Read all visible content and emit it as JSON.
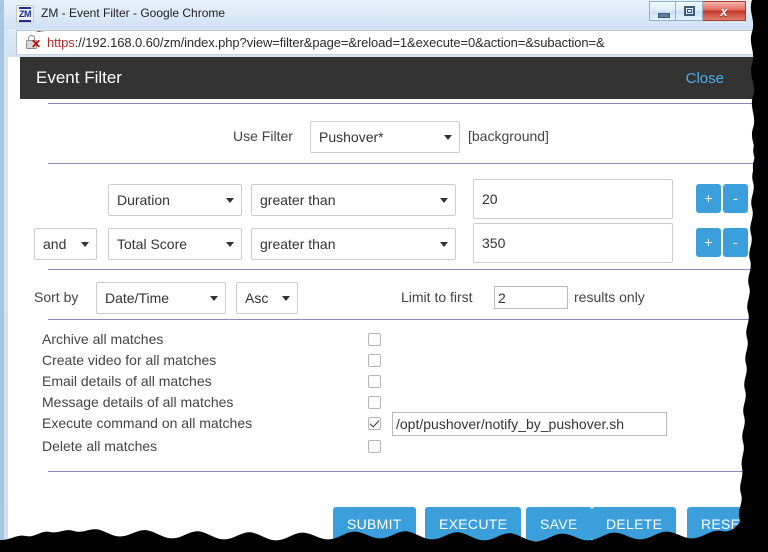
{
  "window": {
    "title": "ZM - Event Filter - Google Chrome",
    "favicon": "zm-favicon",
    "minimize_label": "Minimize",
    "maximize_label": "Maximize",
    "close_label": "x"
  },
  "omnibox": {
    "icon": "broken-https-lock-icon",
    "scheme": "https",
    "rest": "://192.168.0.60/zm/index.php?view=filter&page=&reload=1&execute=0&action=&subaction=&"
  },
  "modal": {
    "title": "Event Filter",
    "close_label": "Close"
  },
  "filter": {
    "use_filter_label": "Use Filter",
    "selected_filter": "Pushover*",
    "background_label": "[background]"
  },
  "terms": [
    {
      "conjunction": "",
      "attribute": "Duration",
      "operator": "greater than",
      "value": "20",
      "add_label": "+",
      "remove_label": "-"
    },
    {
      "conjunction": "and",
      "attribute": "Total Score",
      "operator": "greater than",
      "value": "350",
      "add_label": "+",
      "remove_label": "-"
    }
  ],
  "sort": {
    "sort_by_label": "Sort by",
    "sort_field": "Date/Time",
    "sort_direction": "Asc",
    "limit_prefix": "Limit to first",
    "limit_value": "2",
    "limit_suffix": "results only"
  },
  "actions": [
    {
      "label": "Archive all matches",
      "checked": false
    },
    {
      "label": "Create video for all matches",
      "checked": false
    },
    {
      "label": "Email details of all matches",
      "checked": false
    },
    {
      "label": "Message details of all matches",
      "checked": false
    },
    {
      "label": "Execute command on all matches",
      "checked": true,
      "command": "/opt/pushover/notify_by_pushover.sh"
    },
    {
      "label": "Delete all matches",
      "checked": false
    }
  ],
  "buttons": [
    {
      "label": "SUBMIT"
    },
    {
      "label": "EXECUTE"
    },
    {
      "label": "SAVE"
    },
    {
      "label": "DELETE"
    },
    {
      "label": "RESET"
    }
  ],
  "colors": {
    "accent_blue": "#3b9fdb",
    "modal_header": "#333333",
    "link_blue": "#4eaee8",
    "divider": "#8b8bb5"
  }
}
